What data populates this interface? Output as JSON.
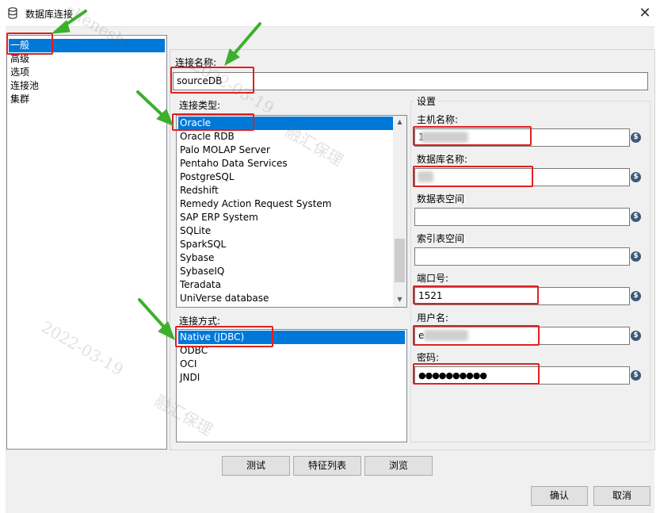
{
  "window": {
    "title": "数据库连接",
    "close_glyph": "✕"
  },
  "categories": [
    {
      "label": "一般",
      "selected": true
    },
    {
      "label": "高级",
      "selected": false
    },
    {
      "label": "选项",
      "selected": false
    },
    {
      "label": "连接池",
      "selected": false
    },
    {
      "label": "集群",
      "selected": false
    }
  ],
  "connection_name": {
    "label": "连接名称:",
    "value": "sourceDB"
  },
  "connection_type": {
    "label": "连接类型:",
    "items": [
      {
        "label": "Oracle",
        "selected": true
      },
      {
        "label": "Oracle RDB",
        "selected": false
      },
      {
        "label": "Palo MOLAP Server",
        "selected": false
      },
      {
        "label": "Pentaho Data Services",
        "selected": false
      },
      {
        "label": "PostgreSQL",
        "selected": false
      },
      {
        "label": "Redshift",
        "selected": false
      },
      {
        "label": "Remedy Action Request System",
        "selected": false
      },
      {
        "label": "SAP ERP System",
        "selected": false
      },
      {
        "label": "SQLite",
        "selected": false
      },
      {
        "label": "SparkSQL",
        "selected": false
      },
      {
        "label": "Sybase",
        "selected": false
      },
      {
        "label": "SybaseIQ",
        "selected": false
      },
      {
        "label": "Teradata",
        "selected": false
      },
      {
        "label": "UniVerse database",
        "selected": false
      }
    ]
  },
  "access_method": {
    "label": "连接方式:",
    "items": [
      {
        "label": "Native (JDBC)",
        "selected": true
      },
      {
        "label": "ODBC",
        "selected": false
      },
      {
        "label": "OCI",
        "selected": false
      },
      {
        "label": "JNDI",
        "selected": false
      }
    ]
  },
  "settings": {
    "legend": "设置",
    "fields": [
      {
        "label": "主机名称:",
        "value": "1"
      },
      {
        "label": "数据库名称:",
        "value": ""
      },
      {
        "label": "数据表空间",
        "value": ""
      },
      {
        "label": "索引表空间",
        "value": ""
      },
      {
        "label": "端口号:",
        "value": "1521"
      },
      {
        "label": "用户名:",
        "value": "e"
      },
      {
        "label": "密码:",
        "value": "●●●●●●●●●●"
      }
    ],
    "variable_icon": "$"
  },
  "buttons": {
    "test": "测试",
    "feature_list": "特征列表",
    "explore": "浏览",
    "ok": "确认",
    "cancel": "取消"
  },
  "watermark": {
    "text_1": "2022-03-19",
    "text_2": "融汇保理",
    "text_3": "chenesh"
  },
  "colors": {
    "selection": "#0078d7",
    "annotation_red": "#e02020",
    "annotation_green": "#3cb02c",
    "variable_icon": "#3c5a78"
  }
}
